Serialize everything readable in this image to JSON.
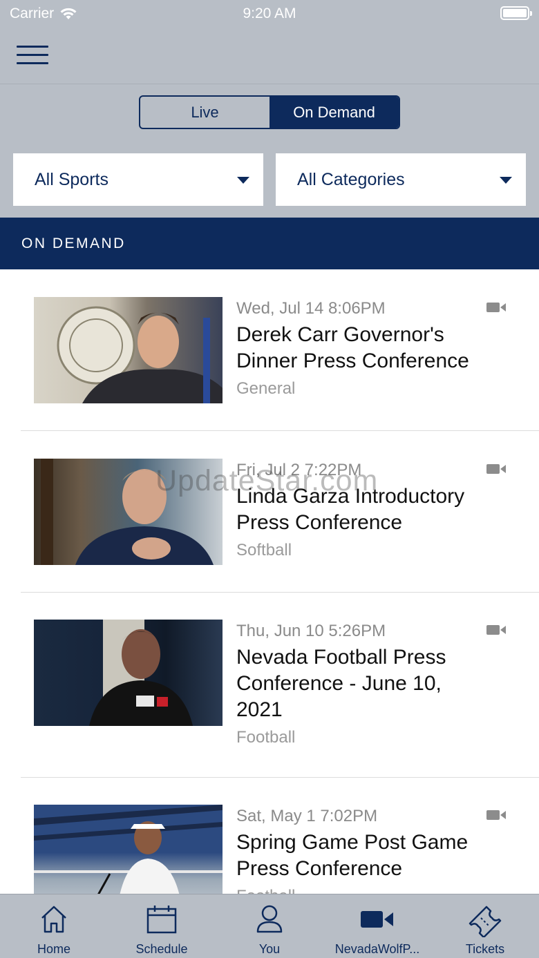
{
  "status_bar": {
    "carrier": "Carrier",
    "time": "9:20 AM"
  },
  "segments": {
    "live": "Live",
    "on_demand": "On Demand",
    "selected": "On Demand"
  },
  "filters": {
    "sports": "All Sports",
    "categories": "All Categories"
  },
  "section_title": "ON DEMAND",
  "items": [
    {
      "date": "Wed, Jul 14 8:06PM",
      "title": "Derek Carr Governor's Dinner Press Conference",
      "category": "General",
      "icon": "video-camera-icon"
    },
    {
      "date": "Fri, Jul 2 7:22PM",
      "title": "Linda Garza Introductory Press Conference",
      "category": "Softball",
      "icon": "video-camera-icon"
    },
    {
      "date": "Thu, Jun 10 5:26PM",
      "title": "Nevada Football Press Conference - June 10, 2021",
      "category": "Football",
      "icon": "video-camera-icon"
    },
    {
      "date": "Sat, May 1 7:02PM",
      "title": "Spring Game Post Game Press Conference",
      "category": "Football",
      "icon": "video-camera-icon"
    }
  ],
  "watermark": "UpdateStar.com",
  "tabs": [
    {
      "label": "Home",
      "icon": "home-icon"
    },
    {
      "label": "Schedule",
      "icon": "calendar-icon"
    },
    {
      "label": "You",
      "icon": "person-icon"
    },
    {
      "label": "NevadaWolfP...",
      "icon": "video-camera-icon"
    },
    {
      "label": "Tickets",
      "icon": "ticket-icon"
    }
  ],
  "colors": {
    "navy": "#0d2a5c",
    "chrome_gray": "#b8bec6",
    "white": "#ffffff"
  }
}
